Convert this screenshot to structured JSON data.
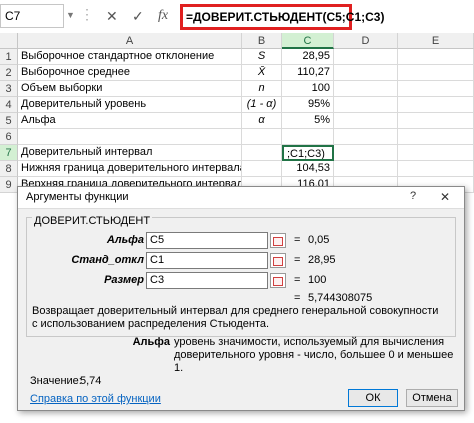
{
  "formula_bar": {
    "name_box": "C7",
    "formula": "=ДОВЕРИТ.СТЬЮДЕНТ(C5;C1;C3)",
    "cancel_icon": "✕",
    "enter_icon": "✓",
    "fx_label": "fx"
  },
  "columns": [
    "A",
    "B",
    "C",
    "D",
    "E"
  ],
  "rows": [
    {
      "num": "1",
      "a": "Выборочное стандартное отклонение",
      "b": "S",
      "c": "28,95"
    },
    {
      "num": "2",
      "a": "Выборочное среднее",
      "b": "X̄",
      "c": "110,27"
    },
    {
      "num": "3",
      "a": "Объем выборки",
      "b": "n",
      "c": "100"
    },
    {
      "num": "4",
      "a": "Доверительный уровень",
      "b": "(1 - α)",
      "c": "95%"
    },
    {
      "num": "5",
      "a": "Альфа",
      "b": "α",
      "c": "5%"
    },
    {
      "num": "6",
      "a": "",
      "b": "",
      "c": ""
    },
    {
      "num": "7",
      "a": "Доверительный интервал",
      "b": "",
      "c": ";C1;C3)"
    },
    {
      "num": "8",
      "a": "Нижняя граница доверительного интервала",
      "b": "",
      "c": "104,53"
    },
    {
      "num": "9",
      "a": "Верхняя граница доверительного интервала",
      "b": "",
      "c": "116,01"
    }
  ],
  "dialog": {
    "title": "Аргументы функции",
    "help_symbol": "?",
    "close_symbol": "✕",
    "function_name": "ДОВЕРИТ.СТЬЮДЕНТ",
    "args": [
      {
        "label": "Альфа",
        "value": "C5",
        "result": "0,05"
      },
      {
        "label": "Станд_откл",
        "value": "C1",
        "result": "28,95"
      },
      {
        "label": "Размер",
        "value": "C3",
        "result": "100"
      }
    ],
    "equals": "=",
    "total": "5,744308075",
    "description": "Возвращает доверительный интервал для среднего генеральной совокупности с использованием распределения Стьюдента.",
    "arg_help_label": "Альфа",
    "arg_help_text": "уровень значимости, используемый для вычисления доверительного уровня - число, большее 0 и меньшее 1.",
    "value_label": "Значение:",
    "value": "5,74",
    "help_link": "Справка по этой функции",
    "ok": "ОК",
    "cancel": "Отмена"
  }
}
